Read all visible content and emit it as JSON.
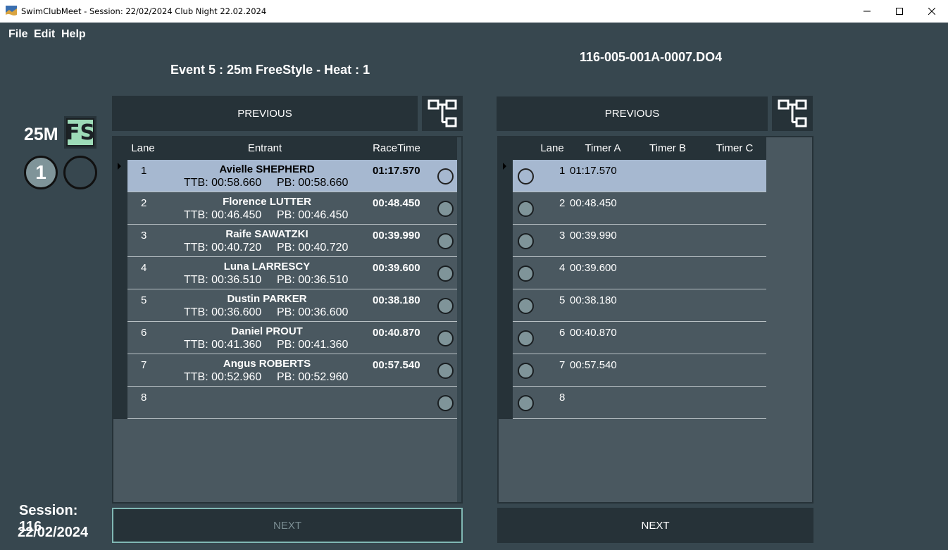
{
  "window": {
    "title": "SwimClubMeet - Session: 22/02/2024 Club Night 22.02.2024"
  },
  "menu": [
    "File",
    "Edit",
    "Help"
  ],
  "event_title": "Event 5 : 25m FreeStyle - Heat : 1",
  "file_name": "116-005-001A-0007.DO4",
  "left_info": {
    "distance": "25M",
    "stroke_badge": "FS",
    "heat_number": "1",
    "session_label": "Session: 116",
    "session_date": "22/02/2024"
  },
  "colors": {
    "background": "#37474f",
    "panel": "#263238",
    "selected_row": "#a6b8d0",
    "badge_fill": "#9ddbb8"
  },
  "left_grid": {
    "previous_label": "PREVIOUS",
    "next_label": "NEXT",
    "headers": {
      "lane": "Lane",
      "entrant": "Entrant",
      "racetime": "RaceTime"
    },
    "rows": [
      {
        "lane": "1",
        "name": "Avielle SHEPHERD",
        "ttb": "TTB: 00:58.660",
        "pb": "PB: 00:58.660",
        "racetime": "01:17.570"
      },
      {
        "lane": "2",
        "name": "Florence LUTTER",
        "ttb": "TTB: 00:46.450",
        "pb": "PB: 00:46.450",
        "racetime": "00:48.450"
      },
      {
        "lane": "3",
        "name": "Raife SAWATZKI",
        "ttb": "TTB: 00:40.720",
        "pb": "PB: 00:40.720",
        "racetime": "00:39.990"
      },
      {
        "lane": "4",
        "name": "Luna LARRESCY",
        "ttb": "TTB: 00:36.510",
        "pb": "PB: 00:36.510",
        "racetime": "00:39.600"
      },
      {
        "lane": "5",
        "name": "Dustin PARKER",
        "ttb": "TTB: 00:36.600",
        "pb": "PB: 00:36.600",
        "racetime": "00:38.180"
      },
      {
        "lane": "6",
        "name": "Daniel PROUT",
        "ttb": "TTB: 00:41.360",
        "pb": "PB: 00:41.360",
        "racetime": "00:40.870"
      },
      {
        "lane": "7",
        "name": "Angus ROBERTS",
        "ttb": "TTB: 00:52.960",
        "pb": "PB: 00:52.960",
        "racetime": "00:57.540"
      },
      {
        "lane": "8",
        "name": "",
        "ttb": "",
        "pb": "",
        "racetime": ""
      }
    ]
  },
  "right_grid": {
    "previous_label": "PREVIOUS",
    "next_label": "NEXT",
    "headers": {
      "lane": "Lane",
      "timer_a": "Timer A",
      "timer_b": "Timer B",
      "timer_c": "Timer C"
    },
    "rows": [
      {
        "lane": "1",
        "timer_a": "01:17.570"
      },
      {
        "lane": "2",
        "timer_a": "00:48.450"
      },
      {
        "lane": "3",
        "timer_a": "00:39.990"
      },
      {
        "lane": "4",
        "timer_a": "00:39.600"
      },
      {
        "lane": "5",
        "timer_a": "00:38.180"
      },
      {
        "lane": "6",
        "timer_a": "00:40.870"
      },
      {
        "lane": "7",
        "timer_a": "00:57.540"
      },
      {
        "lane": "8",
        "timer_a": ""
      }
    ]
  }
}
